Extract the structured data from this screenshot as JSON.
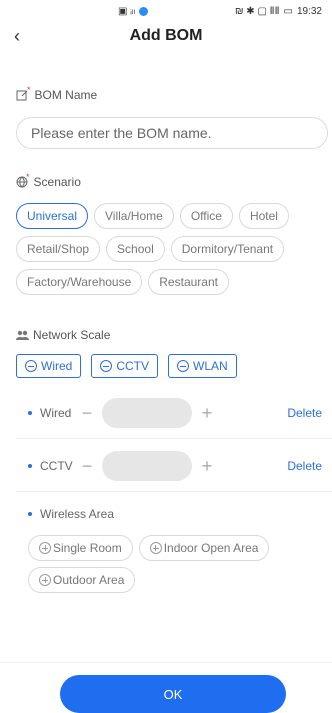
{
  "status_bar": {
    "left_icons": "▣ ᵢₗₗ",
    "right_icons": "₪ ✱ ▢ ⅡⅡ",
    "battery": "▭",
    "time": "19:32"
  },
  "header": {
    "title": "Add BOM",
    "back_icon": "back-arrow-icon"
  },
  "bom_name": {
    "label": "BOM Name",
    "placeholder": "Please enter the BOM name."
  },
  "scenario": {
    "label": "Scenario",
    "options": [
      "Universal",
      "Villa/Home",
      "Office",
      "Hotel",
      "Retail/Shop",
      "School",
      "Dormitory/Tenant",
      "Factory/Warehouse",
      "Restaurant"
    ],
    "selected": "Universal"
  },
  "network_scale": {
    "label": "Network Scale",
    "buttons": [
      "Wired",
      "CCTV",
      "WLAN"
    ]
  },
  "rows": [
    {
      "name": "Wired",
      "delete_label": "Delete"
    },
    {
      "name": "CCTV",
      "delete_label": "Delete"
    }
  ],
  "wireless": {
    "label": "Wireless Area",
    "options": [
      "Single Room",
      "Indoor Open Area",
      "Outdoor Area"
    ]
  },
  "ok_label": "OK",
  "colors": {
    "accent": "#1f6ef0",
    "required": "#e53935"
  }
}
